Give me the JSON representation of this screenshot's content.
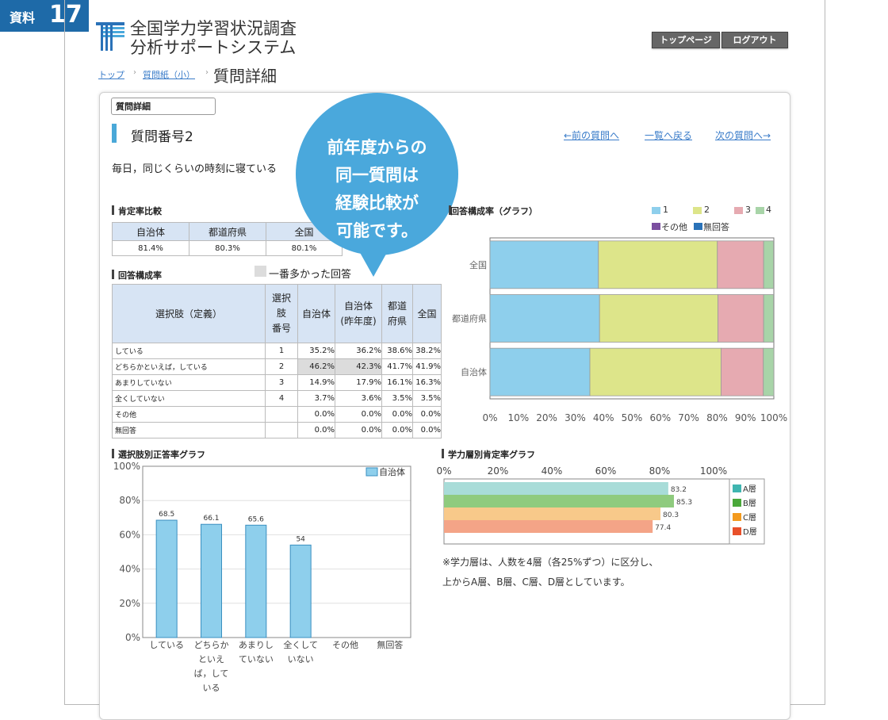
{
  "tag": {
    "label": "資料",
    "number": "17"
  },
  "app": {
    "title_line1": "全国学力学習状況調査",
    "title_line2": "分析サポートシステム"
  },
  "header": {
    "top_page": "トップページ",
    "logout": "ログアウト"
  },
  "breadcrumb": {
    "top": "トップ",
    "questionnaire": "質問紙（小）",
    "current": "質問詳細"
  },
  "panel": {
    "tab": "質問詳細",
    "question_number": "質問番号2",
    "nav_prev": "←前の質問へ",
    "nav_list": "一覧へ戻る",
    "nav_next": "次の質問へ→",
    "question_text": "毎日，同じくらいの時刻に寝ている"
  },
  "callout": {
    "lines": [
      "前年度からの",
      "同一質問は",
      "経験比較が",
      "可能です。"
    ]
  },
  "affirmation": {
    "title": "肯定率比較",
    "headers": [
      "自治体",
      "都道府県",
      "全国"
    ],
    "values": [
      "81.4%",
      "80.3%",
      "80.1%"
    ]
  },
  "response": {
    "title": "回答構成率",
    "legend_most": "一番多かった回答",
    "headers": {
      "choice": "選択肢（定義）",
      "num": [
        "選択",
        "肢",
        "番号"
      ],
      "muni": "自治体",
      "muni_prev": [
        "自治体",
        "(昨年度)"
      ],
      "pref": [
        "都道",
        "府県"
      ],
      "nat": "全国"
    },
    "rows": [
      {
        "label": "している",
        "num": "1",
        "muni": "35.2%",
        "prev": "36.2%",
        "pref": "38.6%",
        "nat": "38.2%",
        "hl": false
      },
      {
        "label": "どちらかといえば，している",
        "num": "2",
        "muni": "46.2%",
        "prev": "42.3%",
        "pref": "41.7%",
        "nat": "41.9%",
        "hl": true
      },
      {
        "label": "あまりしていない",
        "num": "3",
        "muni": "14.9%",
        "prev": "17.9%",
        "pref": "16.1%",
        "nat": "16.3%",
        "hl": false
      },
      {
        "label": "全くしていない",
        "num": "4",
        "muni": "3.7%",
        "prev": "3.6%",
        "pref": "3.5%",
        "nat": "3.5%",
        "hl": false
      },
      {
        "label": "その他",
        "num": "",
        "muni": "0.0%",
        "prev": "0.0%",
        "pref": "0.0%",
        "nat": "0.0%",
        "hl": false
      },
      {
        "label": "無回答",
        "num": "",
        "muni": "0.0%",
        "prev": "0.0%",
        "pref": "0.0%",
        "nat": "0.0%",
        "hl": false
      }
    ]
  },
  "charts": {
    "comp_title": "回答構成率（グラフ）",
    "choice_title": "選択肢別正答率グラフ",
    "level_title": "学力層別肯定率グラフ"
  },
  "level_note": {
    "line1": "※学力層は、人数を4層（各25%ずつ）に区分し、",
    "line2": "上からA層、B層、C層、D層としています。"
  },
  "colors": {
    "c1": "#8ecfec",
    "c2": "#dde58a",
    "c3": "#e6aab1",
    "c4": "#a8d4a8",
    "other": "#7b4fa0",
    "none": "#2a72b8"
  },
  "chart_data": [
    {
      "type": "bar",
      "orientation": "horizontal",
      "stacked": true,
      "title": "回答構成率（グラフ）",
      "categories": [
        "全国",
        "都道府県",
        "自治体"
      ],
      "series": [
        {
          "name": "1",
          "color": "#8ecfec",
          "values": [
            38.2,
            38.6,
            35.2
          ]
        },
        {
          "name": "2",
          "color": "#dde58a",
          "values": [
            41.9,
            41.7,
            46.2
          ]
        },
        {
          "name": "3",
          "color": "#e6aab1",
          "values": [
            16.3,
            16.1,
            14.9
          ]
        },
        {
          "name": "4",
          "color": "#a8d4a8",
          "values": [
            3.5,
            3.5,
            3.7
          ]
        },
        {
          "name": "その他",
          "color": "#7b4fa0",
          "values": [
            0,
            0,
            0
          ]
        },
        {
          "name": "無回答",
          "color": "#2a72b8",
          "values": [
            0,
            0,
            0
          ]
        }
      ],
      "xlim": [
        0,
        100
      ],
      "xticks": [
        "0%",
        "10%",
        "20%",
        "30%",
        "40%",
        "50%",
        "60%",
        "70%",
        "80%",
        "90%",
        "100%"
      ],
      "legend": "top-right"
    },
    {
      "type": "bar",
      "title": "選択肢別正答率グラフ",
      "categories": [
        [
          "している"
        ],
        [
          "どちらか",
          "といえ",
          "ば，して",
          "いる"
        ],
        [
          "あまりし",
          "ていない"
        ],
        [
          "全くして",
          "いない"
        ],
        [
          "その他"
        ],
        [
          "無回答"
        ]
      ],
      "series": [
        {
          "name": "自治体",
          "color": "#8ecfec",
          "values": [
            68.5,
            66.1,
            65.6,
            54,
            null,
            null
          ],
          "labels": [
            "68.5",
            "66.1",
            "65.6",
            "54",
            "",
            ""
          ]
        }
      ],
      "ylim": [
        0,
        100
      ],
      "yticks": [
        "0%",
        "20%",
        "40%",
        "60%",
        "80%",
        "100%"
      ],
      "grid": true,
      "legend": "top-right"
    },
    {
      "type": "bar",
      "orientation": "horizontal",
      "title": "学力層別肯定率グラフ",
      "categories": [
        "A層",
        "B層",
        "C層",
        "D層"
      ],
      "series": [
        {
          "name": "肯定率",
          "values": [
            83.2,
            85.3,
            80.3,
            77.4
          ],
          "labels": [
            "83.2",
            "85.3",
            "80.3",
            "77.4"
          ]
        }
      ],
      "colors": [
        "#a8dcd8",
        "#8fcb7e",
        "#f8c98a",
        "#f4a487"
      ],
      "swatch_colors": [
        "#3fb5b0",
        "#4aa83a",
        "#f39a1e",
        "#e8502a"
      ],
      "xlim": [
        0,
        100
      ],
      "xticks": [
        "0%",
        "20%",
        "40%",
        "60%",
        "80%",
        "100%"
      ],
      "legend": "right"
    }
  ]
}
